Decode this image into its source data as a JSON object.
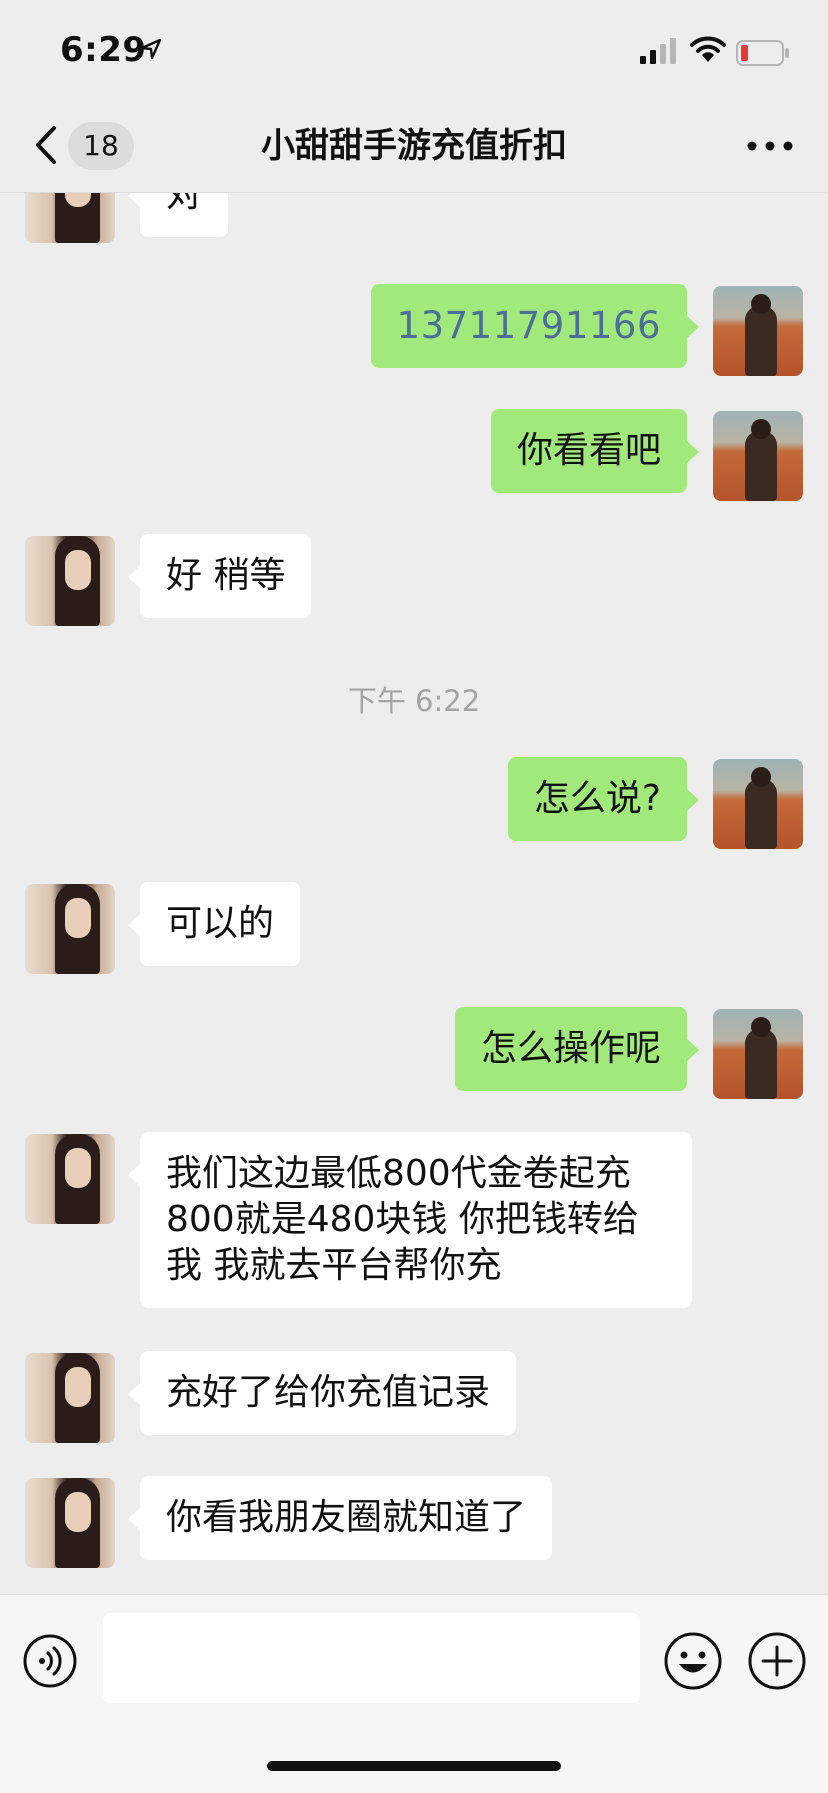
{
  "status_bar": {
    "time": "6:29",
    "icons": [
      "location-arrow-icon",
      "cellular-signal-icon",
      "wifi-icon",
      "battery-low-icon"
    ],
    "battery_color": "#e53935"
  },
  "nav": {
    "unread_count": "18",
    "title": "小甜甜手游充值折扣",
    "icons": [
      "back-chevron-icon",
      "more-dots-icon"
    ]
  },
  "colors": {
    "background": "#ededed",
    "incoming_bubble": "#ffffff",
    "outgoing_bubble": "#a0e97a",
    "phone_link": "#4c6f99"
  },
  "messages": [
    {
      "from": "contact",
      "text": "对"
    },
    {
      "from": "me",
      "text": "13711791166"
    },
    {
      "from": "me",
      "text": "你看看吧"
    },
    {
      "from": "contact",
      "text": "好 稍等"
    },
    {
      "type": "timestamp",
      "text": "下午 6:22"
    },
    {
      "from": "me",
      "text": "怎么说?"
    },
    {
      "from": "contact",
      "text": "可以的"
    },
    {
      "from": "me",
      "text": "怎么操作呢"
    },
    {
      "from": "contact",
      "text": "我们这边最低800代金卷起充\n800就是480块钱 你把钱转给\n我 我就去平台帮你充"
    },
    {
      "from": "contact",
      "text": "充好了给你充值记录"
    },
    {
      "from": "contact",
      "text": "你看我朋友圈就知道了"
    }
  ],
  "input_bar": {
    "value": "",
    "icons": [
      "voice-icon",
      "emoji-icon",
      "plus-icon"
    ]
  }
}
